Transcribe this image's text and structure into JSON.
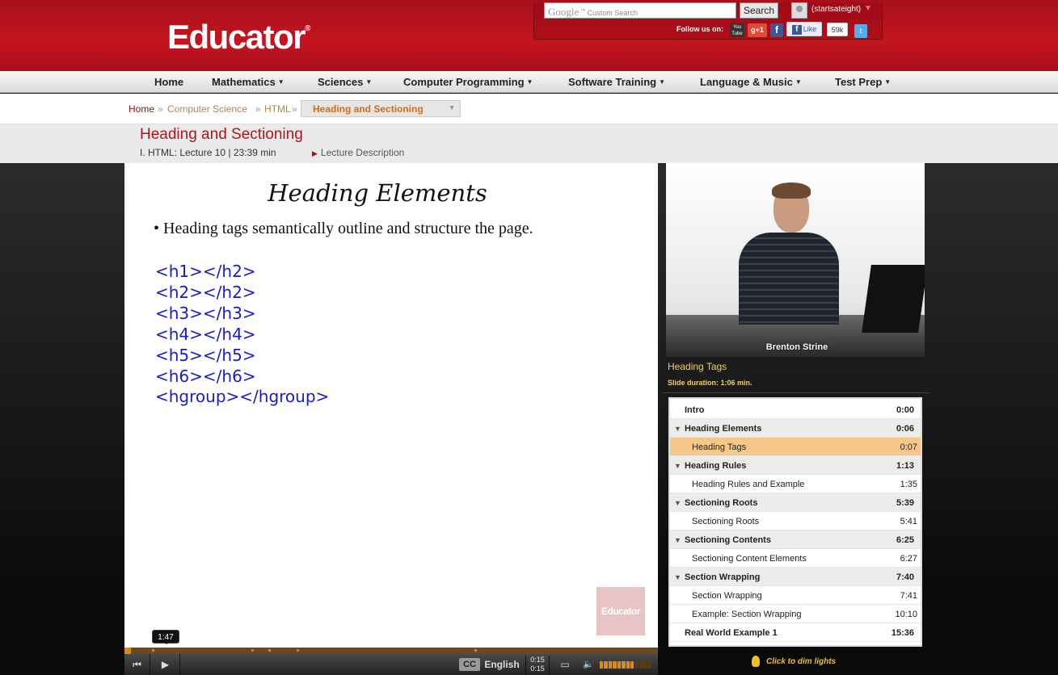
{
  "header": {
    "logo": "Educator",
    "logo_mark": "®",
    "search": {
      "google": "Google",
      "tm": "™",
      "placeholder": "Custom Search",
      "button": "Search"
    },
    "username": "(startsateight)",
    "follow_label": "Follow us on:",
    "social": {
      "youtube": "You Tube",
      "gplus": "g+1",
      "facebook": "f",
      "like": "Like",
      "like_count": "59k"
    }
  },
  "nav": [
    "Home",
    "Mathematics",
    "Sciences",
    "Computer Programming",
    "Software Training",
    "Language & Music",
    "Test Prep"
  ],
  "breadcrumb": {
    "home": "Home",
    "items": [
      "Computer Science",
      "HTML"
    ],
    "separator": "»",
    "current": "Heading and Sectioning"
  },
  "lecture": {
    "title": "Heading and Sectioning",
    "meta": "I. HTML: Lecture 10 | 23:39 min",
    "description_link": "Lecture Description"
  },
  "slide": {
    "title": "Heading Elements",
    "bullet": "Heading tags semantically outline and structure the page.",
    "code": [
      "<h1></h2>",
      "<h2></h2>",
      "<h3></h3>",
      "<h4></h4>",
      "<h5></h5>",
      "<h6></h6>",
      "<hgroup></hgroup>"
    ],
    "watermark": "Educator"
  },
  "player": {
    "tooltip": "1:47",
    "cc": "CC",
    "language": "English",
    "time_current": "0:15",
    "time_total": "0:15",
    "volume_level": 0.7
  },
  "side": {
    "speaker": "Brenton Strine",
    "current_slide": "Heading Tags",
    "slide_duration": "Slide duration: 1:06 min.",
    "dim_lights": "Click to dim lights"
  },
  "toc": [
    {
      "type": "plain",
      "label": "Intro",
      "time": "0:00"
    },
    {
      "type": "section",
      "label": "Heading Elements",
      "time": "0:06"
    },
    {
      "type": "child",
      "label": "Heading Tags",
      "time": "0:07",
      "active": true
    },
    {
      "type": "section",
      "label": "Heading Rules",
      "time": "1:13"
    },
    {
      "type": "child",
      "label": "Heading Rules and Example",
      "time": "1:35"
    },
    {
      "type": "section",
      "label": "Sectioning Roots",
      "time": "5:39"
    },
    {
      "type": "child",
      "label": "Sectioning Roots",
      "time": "5:41"
    },
    {
      "type": "section",
      "label": "Sectioning Contents",
      "time": "6:25"
    },
    {
      "type": "child",
      "label": "Sectioning Content Elements",
      "time": "6:27"
    },
    {
      "type": "section",
      "label": "Section Wrapping",
      "time": "7:40"
    },
    {
      "type": "child",
      "label": "Section Wrapping",
      "time": "7:41"
    },
    {
      "type": "child",
      "label": "Example: Section Wrapping",
      "time": "10:10"
    },
    {
      "type": "plain",
      "label": "Real World Example 1",
      "time": "15:36"
    }
  ]
}
